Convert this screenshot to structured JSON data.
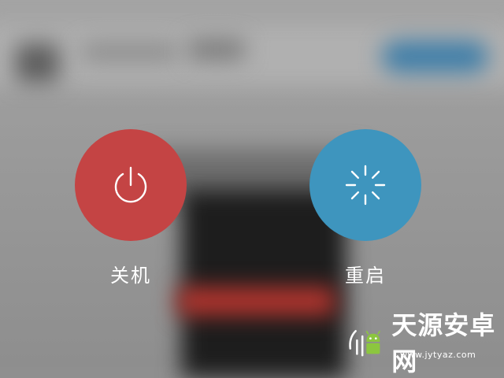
{
  "shutdown": {
    "label": "关机",
    "icon": "power-icon",
    "color": "#c44444"
  },
  "restart": {
    "label": "重启",
    "icon": "loading-spinner-icon",
    "color": "#3e95be"
  },
  "watermark": {
    "brand": "天源安卓网",
    "url": "www.jytyaz.com"
  }
}
